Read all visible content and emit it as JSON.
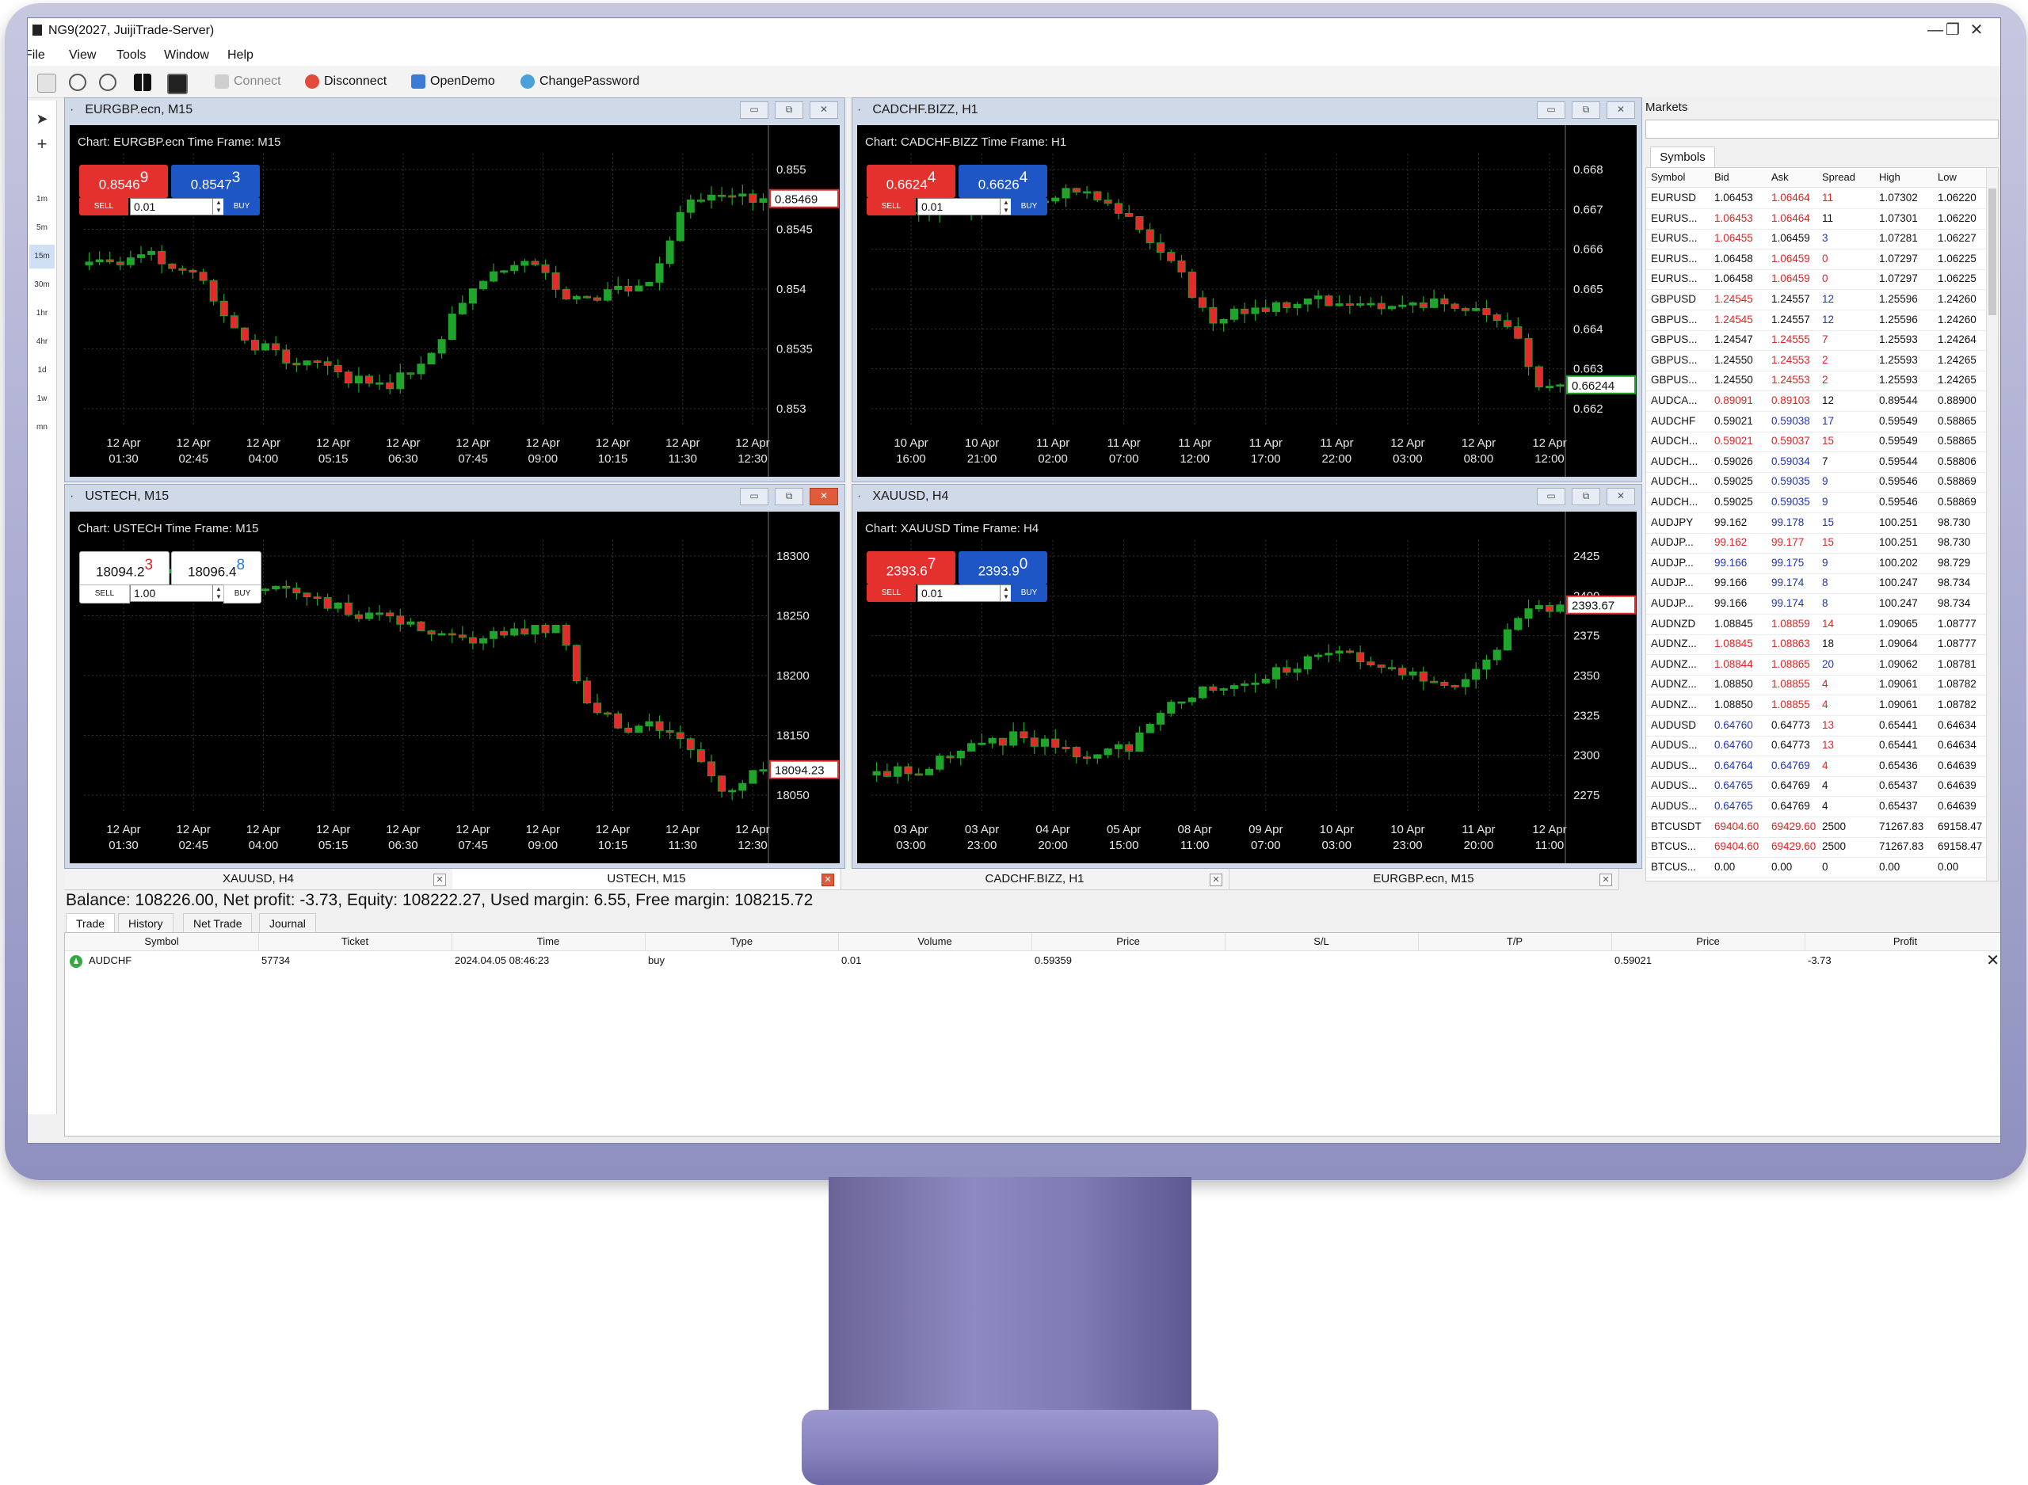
{
  "window": {
    "title": "NG9(2027, JuijiTrade-Server)",
    "minimize": "—",
    "maximize": "❐",
    "close": "✕"
  },
  "menu": [
    "File",
    "View",
    "Tools",
    "Window",
    "Help"
  ],
  "toolbar": {
    "connect": "Connect",
    "disconnect": "Disconnect",
    "opendemo": "OpenDemo",
    "changepassword": "ChangePassword"
  },
  "timeframes": [
    "1m",
    "5m",
    "15m",
    "30m",
    "1hr",
    "4hr",
    "1d",
    "1w",
    "mn"
  ],
  "colors": {
    "bull": "#1fa52b",
    "bear": "#e42a2a",
    "sell": "#e5312e",
    "buy": "#1e56c6",
    "chart_bg": "#000000"
  },
  "charts": [
    {
      "window_title": "EURGBP.ecn, M15",
      "header": "Chart: EURGBP.ecn Time Frame: M15",
      "sell": {
        "price": "0.8546",
        "sup": "9",
        "label": "SELL"
      },
      "buy": {
        "price": "0.8547",
        "sup": "3",
        "label": "BUY"
      },
      "lot": "0.01",
      "style": "color",
      "current": "0.85469",
      "y_ticks": [
        "0.855",
        "0.8545",
        "0.854",
        "0.8535",
        "0.853"
      ],
      "x_ticks": [
        [
          "12 Apr",
          "01:30"
        ],
        [
          "12 Apr",
          "02:45"
        ],
        [
          "12 Apr",
          "04:00"
        ],
        [
          "12 Apr",
          "05:15"
        ],
        [
          "12 Apr",
          "06:30"
        ],
        [
          "12 Apr",
          "07:45"
        ],
        [
          "12 Apr",
          "09:00"
        ],
        [
          "12 Apr",
          "10:15"
        ],
        [
          "12 Apr",
          "11:30"
        ],
        [
          "12 Apr",
          "12:30"
        ]
      ]
    },
    {
      "window_title": "CADCHF.BIZZ, H1",
      "header": "Chart: CADCHF.BIZZ Time Frame: H1",
      "sell": {
        "price": "0.6624",
        "sup": "4",
        "label": "SELL"
      },
      "buy": {
        "price": "0.6626",
        "sup": "4",
        "label": "BUY"
      },
      "lot": "0.01",
      "style": "color",
      "current": "0.66244",
      "y_ticks": [
        "0.668",
        "0.667",
        "0.666",
        "0.665",
        "0.664",
        "0.663",
        "0.662"
      ],
      "x_ticks": [
        [
          "10 Apr",
          "16:00"
        ],
        [
          "10 Apr",
          "21:00"
        ],
        [
          "11 Apr",
          "02:00"
        ],
        [
          "11 Apr",
          "07:00"
        ],
        [
          "11 Apr",
          "12:00"
        ],
        [
          "11 Apr",
          "17:00"
        ],
        [
          "11 Apr",
          "22:00"
        ],
        [
          "12 Apr",
          "03:00"
        ],
        [
          "12 Apr",
          "08:00"
        ],
        [
          "12 Apr",
          "12:00"
        ]
      ]
    },
    {
      "window_title": "USTECH, M15",
      "header": "Chart: USTECH Time Frame: M15",
      "sell": {
        "price": "18094.2",
        "sup": "3",
        "label": "SELL"
      },
      "buy": {
        "price": "18096.4",
        "sup": "8",
        "label": "BUY"
      },
      "lot": "1.00",
      "style": "white",
      "current": "18094.23",
      "y_ticks": [
        "18300",
        "18250",
        "18200",
        "18150",
        "18050"
      ],
      "x_ticks": [
        [
          "12 Apr",
          "01:30"
        ],
        [
          "12 Apr",
          "02:45"
        ],
        [
          "12 Apr",
          "04:00"
        ],
        [
          "12 Apr",
          "05:15"
        ],
        [
          "12 Apr",
          "06:30"
        ],
        [
          "12 Apr",
          "07:45"
        ],
        [
          "12 Apr",
          "09:00"
        ],
        [
          "12 Apr",
          "10:15"
        ],
        [
          "12 Apr",
          "11:30"
        ],
        [
          "12 Apr",
          "12:30"
        ]
      ]
    },
    {
      "window_title": "XAUUSD, H4",
      "header": "Chart: XAUUSD Time Frame: H4",
      "sell": {
        "price": "2393.6",
        "sup": "7",
        "label": "SELL"
      },
      "buy": {
        "price": "2393.9",
        "sup": "0",
        "label": "BUY"
      },
      "lot": "0.01",
      "style": "color",
      "current": "2393.67",
      "y_ticks": [
        "2425",
        "2400",
        "2375",
        "2350",
        "2325",
        "2300",
        "2275"
      ],
      "x_ticks": [
        [
          "03 Apr",
          "03:00"
        ],
        [
          "03 Apr",
          "23:00"
        ],
        [
          "04 Apr",
          "20:00"
        ],
        [
          "05 Apr",
          "15:00"
        ],
        [
          "08 Apr",
          "11:00"
        ],
        [
          "09 Apr",
          "07:00"
        ],
        [
          "10 Apr",
          "03:00"
        ],
        [
          "10 Apr",
          "23:00"
        ],
        [
          "11 Apr",
          "20:00"
        ],
        [
          "12 Apr",
          "11:00"
        ]
      ]
    }
  ],
  "chart_tabs": [
    "XAUUSD, H4",
    "USTECH, M15",
    "CADCHF.BIZZ, H1",
    "EURGBP.ecn, M15"
  ],
  "account": {
    "summary": "Balance: 108226.00, Net profit: -3.73, Equity: 108222.27, Used margin: 6.55, Free margin: 108215.72"
  },
  "bottom_tabs": [
    "Trade",
    "History",
    "Net Trade",
    "Journal"
  ],
  "trade_columns": [
    "Symbol",
    "Ticket",
    "Time",
    "Type",
    "Volume",
    "Price",
    "S/L",
    "T/P",
    "Price",
    "Profit"
  ],
  "trades": [
    {
      "symbol": "AUDCHF",
      "ticket": "57734",
      "time": "2024.04.05 08:46:23",
      "type": "buy",
      "volume": "0.01",
      "price": "0.59359",
      "sl": "",
      "tp": "",
      "price2": "0.59021",
      "profit": "-3.73",
      "close": "✕"
    }
  ],
  "markets": {
    "title": "Markets",
    "tab": "Symbols",
    "columns": [
      "Symbol",
      "Bid",
      "Ask",
      "Spread",
      "High",
      "Low"
    ],
    "rows": [
      [
        "EURUSD",
        "1.06453",
        "1.06464",
        "11",
        "1.07302",
        "1.06220",
        "k",
        "r",
        "r"
      ],
      [
        "EURUS...",
        "1.06453",
        "1.06464",
        "11",
        "1.07301",
        "1.06220",
        "r",
        "r",
        "k"
      ],
      [
        "EURUS...",
        "1.06455",
        "1.06459",
        "3",
        "1.07281",
        "1.06227",
        "r",
        "k",
        "b"
      ],
      [
        "EURUS...",
        "1.06458",
        "1.06459",
        "0",
        "1.07297",
        "1.06225",
        "k",
        "r",
        "r"
      ],
      [
        "EURUS...",
        "1.06458",
        "1.06459",
        "0",
        "1.07297",
        "1.06225",
        "k",
        "r",
        "r"
      ],
      [
        "GBPUSD",
        "1.24545",
        "1.24557",
        "12",
        "1.25596",
        "1.24260",
        "r",
        "k",
        "b"
      ],
      [
        "GBPUS...",
        "1.24545",
        "1.24557",
        "12",
        "1.25596",
        "1.24260",
        "r",
        "k",
        "b"
      ],
      [
        "GBPUS...",
        "1.24547",
        "1.24555",
        "7",
        "1.25593",
        "1.24264",
        "k",
        "r",
        "r"
      ],
      [
        "GBPUS...",
        "1.24550",
        "1.24553",
        "2",
        "1.25593",
        "1.24265",
        "k",
        "r",
        "r"
      ],
      [
        "GBPUS...",
        "1.24550",
        "1.24553",
        "2",
        "1.25593",
        "1.24265",
        "k",
        "r",
        "r"
      ],
      [
        "AUDCA...",
        "0.89091",
        "0.89103",
        "12",
        "0.89544",
        "0.88900",
        "r",
        "r",
        "k"
      ],
      [
        "AUDCHF",
        "0.59021",
        "0.59038",
        "17",
        "0.59549",
        "0.58865",
        "k",
        "b",
        "b"
      ],
      [
        "AUDCH...",
        "0.59021",
        "0.59037",
        "15",
        "0.59549",
        "0.58865",
        "r",
        "r",
        "r"
      ],
      [
        "AUDCH...",
        "0.59026",
        "0.59034",
        "7",
        "0.59544",
        "0.58806",
        "k",
        "b",
        "k"
      ],
      [
        "AUDCH...",
        "0.59025",
        "0.59035",
        "9",
        "0.59546",
        "0.58869",
        "k",
        "b",
        "b"
      ],
      [
        "AUDCH...",
        "0.59025",
        "0.59035",
        "9",
        "0.59546",
        "0.58869",
        "k",
        "b",
        "b"
      ],
      [
        "AUDJPY",
        "99.162",
        "99.178",
        "15",
        "100.251",
        "98.730",
        "k",
        "b",
        "b"
      ],
      [
        "AUDJP...",
        "99.162",
        "99.177",
        "15",
        "100.251",
        "98.730",
        "r",
        "r",
        "r"
      ],
      [
        "AUDJP...",
        "99.166",
        "99.175",
        "9",
        "100.202",
        "98.729",
        "b",
        "b",
        "b"
      ],
      [
        "AUDJP...",
        "99.166",
        "99.174",
        "8",
        "100.247",
        "98.734",
        "k",
        "b",
        "b"
      ],
      [
        "AUDJP...",
        "99.166",
        "99.174",
        "8",
        "100.247",
        "98.734",
        "k",
        "b",
        "b"
      ],
      [
        "AUDNZD",
        "1.08845",
        "1.08859",
        "14",
        "1.09065",
        "1.08777",
        "k",
        "r",
        "r"
      ],
      [
        "AUDNZ...",
        "1.08845",
        "1.08863",
        "18",
        "1.09064",
        "1.08777",
        "r",
        "r",
        "k"
      ],
      [
        "AUDNZ...",
        "1.08844",
        "1.08865",
        "20",
        "1.09062",
        "1.08781",
        "r",
        "r",
        "b"
      ],
      [
        "AUDNZ...",
        "1.08850",
        "1.08855",
        "4",
        "1.09061",
        "1.08782",
        "k",
        "r",
        "r"
      ],
      [
        "AUDNZ...",
        "1.08850",
        "1.08855",
        "4",
        "1.09061",
        "1.08782",
        "k",
        "r",
        "r"
      ],
      [
        "AUDUSD",
        "0.64760",
        "0.64773",
        "13",
        "0.65441",
        "0.64634",
        "b",
        "k",
        "r"
      ],
      [
        "AUDUS...",
        "0.64760",
        "0.64773",
        "13",
        "0.65441",
        "0.64634",
        "b",
        "k",
        "r"
      ],
      [
        "AUDUS...",
        "0.64764",
        "0.64769",
        "4",
        "0.65436",
        "0.64639",
        "b",
        "b",
        "r"
      ],
      [
        "AUDUS...",
        "0.64765",
        "0.64769",
        "4",
        "0.65437",
        "0.64639",
        "b",
        "k",
        "k"
      ],
      [
        "AUDUS...",
        "0.64765",
        "0.64769",
        "4",
        "0.65437",
        "0.64639",
        "b",
        "k",
        "k"
      ],
      [
        "BTCUSDT",
        "69404.60",
        "69429.60",
        "2500",
        "71267.83",
        "69158.47",
        "r",
        "r",
        "k"
      ],
      [
        "BTCUS...",
        "69404.60",
        "69429.60",
        "2500",
        "71267.83",
        "69158.47",
        "r",
        "r",
        "k"
      ],
      [
        "BTCUS...",
        "0.00",
        "0.00",
        "0",
        "0.00",
        "0.00",
        "k",
        "k",
        "k"
      ]
    ]
  }
}
